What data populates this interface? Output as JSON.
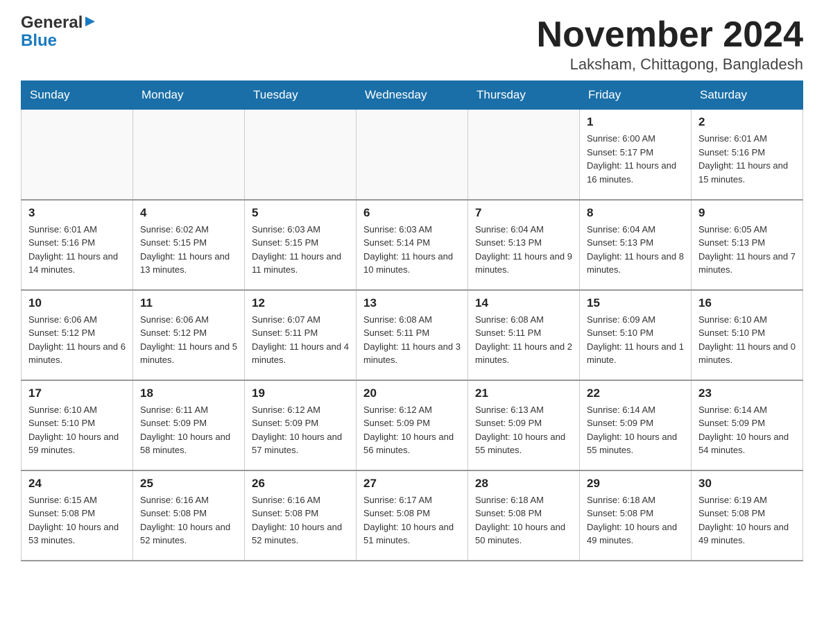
{
  "header": {
    "logo_general": "General",
    "logo_blue": "Blue",
    "title": "November 2024",
    "subtitle": "Laksham, Chittagong, Bangladesh"
  },
  "days_of_week": [
    "Sunday",
    "Monday",
    "Tuesday",
    "Wednesday",
    "Thursday",
    "Friday",
    "Saturday"
  ],
  "weeks": [
    [
      {
        "day": "",
        "info": ""
      },
      {
        "day": "",
        "info": ""
      },
      {
        "day": "",
        "info": ""
      },
      {
        "day": "",
        "info": ""
      },
      {
        "day": "",
        "info": ""
      },
      {
        "day": "1",
        "info": "Sunrise: 6:00 AM\nSunset: 5:17 PM\nDaylight: 11 hours and 16 minutes."
      },
      {
        "day": "2",
        "info": "Sunrise: 6:01 AM\nSunset: 5:16 PM\nDaylight: 11 hours and 15 minutes."
      }
    ],
    [
      {
        "day": "3",
        "info": "Sunrise: 6:01 AM\nSunset: 5:16 PM\nDaylight: 11 hours and 14 minutes."
      },
      {
        "day": "4",
        "info": "Sunrise: 6:02 AM\nSunset: 5:15 PM\nDaylight: 11 hours and 13 minutes."
      },
      {
        "day": "5",
        "info": "Sunrise: 6:03 AM\nSunset: 5:15 PM\nDaylight: 11 hours and 11 minutes."
      },
      {
        "day": "6",
        "info": "Sunrise: 6:03 AM\nSunset: 5:14 PM\nDaylight: 11 hours and 10 minutes."
      },
      {
        "day": "7",
        "info": "Sunrise: 6:04 AM\nSunset: 5:13 PM\nDaylight: 11 hours and 9 minutes."
      },
      {
        "day": "8",
        "info": "Sunrise: 6:04 AM\nSunset: 5:13 PM\nDaylight: 11 hours and 8 minutes."
      },
      {
        "day": "9",
        "info": "Sunrise: 6:05 AM\nSunset: 5:13 PM\nDaylight: 11 hours and 7 minutes."
      }
    ],
    [
      {
        "day": "10",
        "info": "Sunrise: 6:06 AM\nSunset: 5:12 PM\nDaylight: 11 hours and 6 minutes."
      },
      {
        "day": "11",
        "info": "Sunrise: 6:06 AM\nSunset: 5:12 PM\nDaylight: 11 hours and 5 minutes."
      },
      {
        "day": "12",
        "info": "Sunrise: 6:07 AM\nSunset: 5:11 PM\nDaylight: 11 hours and 4 minutes."
      },
      {
        "day": "13",
        "info": "Sunrise: 6:08 AM\nSunset: 5:11 PM\nDaylight: 11 hours and 3 minutes."
      },
      {
        "day": "14",
        "info": "Sunrise: 6:08 AM\nSunset: 5:11 PM\nDaylight: 11 hours and 2 minutes."
      },
      {
        "day": "15",
        "info": "Sunrise: 6:09 AM\nSunset: 5:10 PM\nDaylight: 11 hours and 1 minute."
      },
      {
        "day": "16",
        "info": "Sunrise: 6:10 AM\nSunset: 5:10 PM\nDaylight: 11 hours and 0 minutes."
      }
    ],
    [
      {
        "day": "17",
        "info": "Sunrise: 6:10 AM\nSunset: 5:10 PM\nDaylight: 10 hours and 59 minutes."
      },
      {
        "day": "18",
        "info": "Sunrise: 6:11 AM\nSunset: 5:09 PM\nDaylight: 10 hours and 58 minutes."
      },
      {
        "day": "19",
        "info": "Sunrise: 6:12 AM\nSunset: 5:09 PM\nDaylight: 10 hours and 57 minutes."
      },
      {
        "day": "20",
        "info": "Sunrise: 6:12 AM\nSunset: 5:09 PM\nDaylight: 10 hours and 56 minutes."
      },
      {
        "day": "21",
        "info": "Sunrise: 6:13 AM\nSunset: 5:09 PM\nDaylight: 10 hours and 55 minutes."
      },
      {
        "day": "22",
        "info": "Sunrise: 6:14 AM\nSunset: 5:09 PM\nDaylight: 10 hours and 55 minutes."
      },
      {
        "day": "23",
        "info": "Sunrise: 6:14 AM\nSunset: 5:09 PM\nDaylight: 10 hours and 54 minutes."
      }
    ],
    [
      {
        "day": "24",
        "info": "Sunrise: 6:15 AM\nSunset: 5:08 PM\nDaylight: 10 hours and 53 minutes."
      },
      {
        "day": "25",
        "info": "Sunrise: 6:16 AM\nSunset: 5:08 PM\nDaylight: 10 hours and 52 minutes."
      },
      {
        "day": "26",
        "info": "Sunrise: 6:16 AM\nSunset: 5:08 PM\nDaylight: 10 hours and 52 minutes."
      },
      {
        "day": "27",
        "info": "Sunrise: 6:17 AM\nSunset: 5:08 PM\nDaylight: 10 hours and 51 minutes."
      },
      {
        "day": "28",
        "info": "Sunrise: 6:18 AM\nSunset: 5:08 PM\nDaylight: 10 hours and 50 minutes."
      },
      {
        "day": "29",
        "info": "Sunrise: 6:18 AM\nSunset: 5:08 PM\nDaylight: 10 hours and 49 minutes."
      },
      {
        "day": "30",
        "info": "Sunrise: 6:19 AM\nSunset: 5:08 PM\nDaylight: 10 hours and 49 minutes."
      }
    ]
  ]
}
